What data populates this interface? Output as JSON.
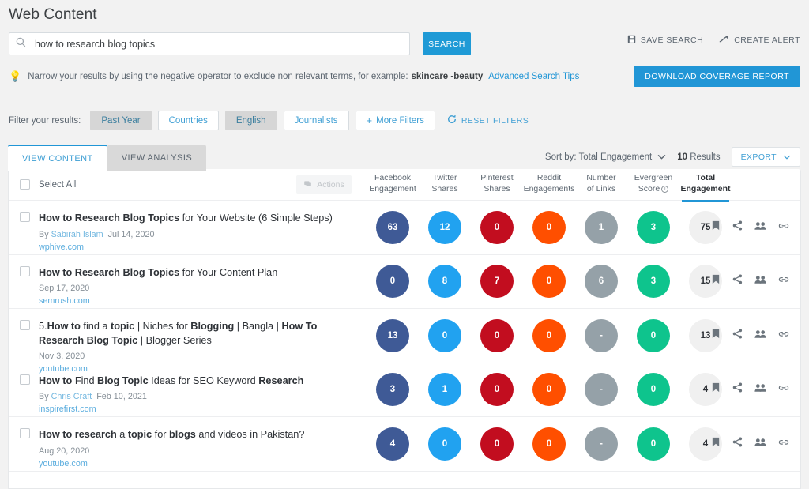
{
  "header": {
    "title": "Web Content",
    "search": {
      "value": "how to research blog topics",
      "placeholder": "Search",
      "button": "SEARCH",
      "icon": "search-icon"
    },
    "save_search": "SAVE SEARCH",
    "create_alert": "CREATE ALERT",
    "download_report": "DOWNLOAD COVERAGE REPORT",
    "hint": {
      "text_before": "Narrow your results by using the negative operator to exclude non relevant terms, for example:",
      "example": "skincare -beauty",
      "link": "Advanced Search Tips"
    }
  },
  "filters": {
    "label": "Filter your results:",
    "chips": [
      {
        "label": "Past Year",
        "active": true
      },
      {
        "label": "Countries",
        "active": false
      },
      {
        "label": "English",
        "active": true
      },
      {
        "label": "Journalists",
        "active": false
      },
      {
        "label": "More Filters",
        "active": false,
        "plus": true
      }
    ],
    "reset": "RESET FILTERS"
  },
  "tabs": [
    {
      "label": "VIEW CONTENT",
      "active": true
    },
    {
      "label": "VIEW ANALYSIS",
      "active": false
    }
  ],
  "toolbar": {
    "sort_by": "Sort by: Total Engagement",
    "results_count": "10",
    "results_label": "Results",
    "export": "EXPORT"
  },
  "table": {
    "select_all": "Select All",
    "actions": "Actions",
    "columns": [
      {
        "line1": "Facebook",
        "line2": "Engagement",
        "color": "#3f5a96",
        "key": "facebook"
      },
      {
        "line1": "Twitter",
        "line2": "Shares",
        "color": "#21a2f0",
        "key": "twitter"
      },
      {
        "line1": "Pinterest",
        "line2": "Shares",
        "color": "#c20d1f",
        "key": "pinterest"
      },
      {
        "line1": "Reddit",
        "line2": "Engagements",
        "color": "#ff4f00",
        "key": "reddit"
      },
      {
        "line1": "Number",
        "line2": "of Links",
        "color": "#95a1a8",
        "key": "links"
      },
      {
        "line1": "Evergreen",
        "line2": "Score",
        "color": "#0ec48d",
        "key": "evergreen",
        "info": true
      },
      {
        "line1": "Total",
        "line2": "Engagement",
        "color": "#f0f0f0",
        "key": "total",
        "highlight": true
      }
    ],
    "rows": [
      {
        "title_html": "<b>How to Research Blog Topics</b> for Your Website (6 Simple Steps)",
        "author": "Sabirah Islam",
        "by_prefix": "By ",
        "date": "Jul 14, 2020",
        "source": "wphive.com",
        "facebook": "63",
        "twitter": "12",
        "pinterest": "0",
        "reddit": "0",
        "links": "1",
        "evergreen": "3",
        "total": "75"
      },
      {
        "title_html": "<b>How to Research Blog Topics</b> for Your Content Plan",
        "author": "",
        "by_prefix": "",
        "date": "Sep 17, 2020",
        "source": "semrush.com",
        "facebook": "0",
        "twitter": "8",
        "pinterest": "7",
        "reddit": "0",
        "links": "6",
        "evergreen": "3",
        "total": "15"
      },
      {
        "title_html": "5.<b>How to</b> find a <b>topic</b> | Niches for <b>Blogging</b> | Bangla | <b>How To Research Blog Topic</b> | Blogger Series",
        "author": "",
        "by_prefix": "",
        "date": "Nov 3, 2020",
        "source": "youtube.com",
        "facebook": "13",
        "twitter": "0",
        "pinterest": "0",
        "reddit": "0",
        "links": "-",
        "evergreen": "0",
        "total": "13"
      },
      {
        "title_html": "<b>How to</b> Find <b>Blog Topic</b> Ideas for SEO Keyword <b>Research</b>",
        "author": "Chris Craft",
        "by_prefix": "By ",
        "date": "Feb 10, 2021",
        "source": "inspirefirst.com",
        "facebook": "3",
        "twitter": "1",
        "pinterest": "0",
        "reddit": "0",
        "links": "-",
        "evergreen": "0",
        "total": "4"
      },
      {
        "title_html": "<b>How to research</b> a <b>topic</b> for <b>blogs</b> and videos in Pakistan?",
        "author": "",
        "by_prefix": "",
        "date": "Aug 20, 2020",
        "source": "youtube.com",
        "facebook": "4",
        "twitter": "0",
        "pinterest": "0",
        "reddit": "0",
        "links": "-",
        "evergreen": "0",
        "total": "4"
      }
    ],
    "row_icons": [
      "bookmark-icon",
      "share-icon",
      "people-icon",
      "link-icon"
    ]
  },
  "colors": {
    "accent": "#2196d6",
    "page_bg": "#f2f2f2",
    "facebook": "#3f5a96",
    "twitter": "#21a2f0",
    "pinterest": "#c20d1f",
    "reddit": "#ff4f00",
    "links": "#95a1a8",
    "evergreen": "#0ec48d",
    "total": "#f0f0f0"
  }
}
